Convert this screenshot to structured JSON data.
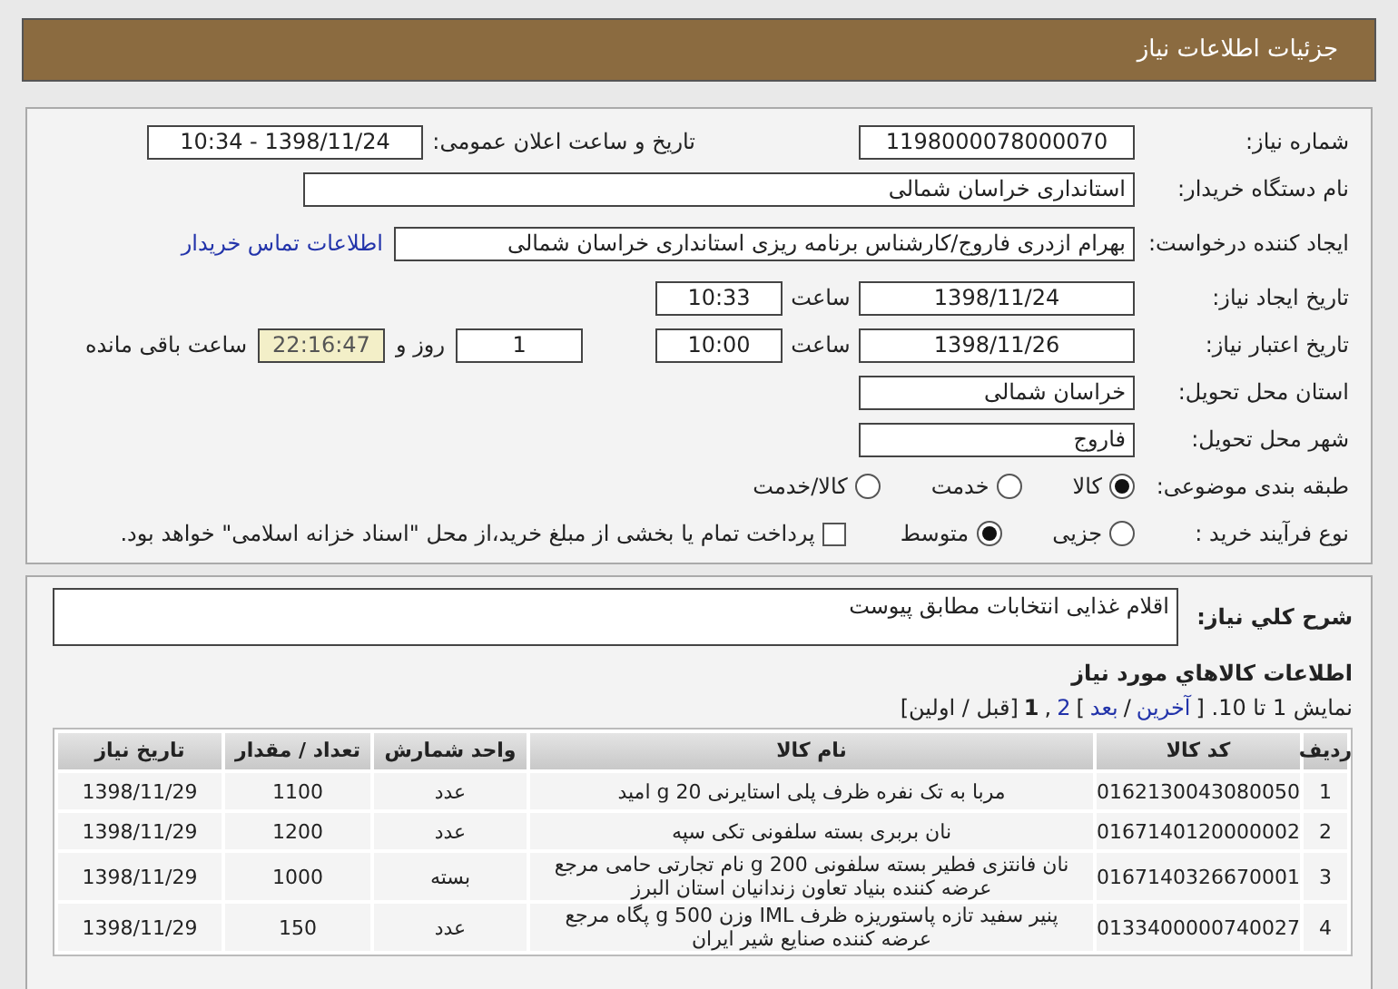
{
  "header": {
    "title": "جزئیات اطلاعات نیاز"
  },
  "details": {
    "need_number": {
      "label": "شماره نیاز:",
      "value": "1198000078000070"
    },
    "announce": {
      "label": "تاریخ و ساعت اعلان عمومی:",
      "value": "1398/11/24 - 10:34"
    },
    "buyer": {
      "label": "نام دستگاه خریدار:",
      "value": "استانداری خراسان شمالی"
    },
    "requester": {
      "label": "ایجاد کننده درخواست:",
      "value": "بهرام ازدری فاروج/کارشناس برنامه ریزی استانداری خراسان شمالی",
      "link": "اطلاعات تماس خریدار"
    },
    "created": {
      "label": "تاریخ ایجاد نیاز:",
      "date": "1398/11/24",
      "time_label": "ساعت",
      "time": "10:33"
    },
    "validity": {
      "label": "تاریخ اعتبار نیاز:",
      "date": "1398/11/26",
      "time_label": "ساعت",
      "time": "10:00",
      "days": "1",
      "days_label": "روز و",
      "remaining": "22:16:47",
      "remaining_label": "ساعت باقی مانده"
    },
    "province": {
      "label": "استان محل تحویل:",
      "value": "خراسان شمالی"
    },
    "city": {
      "label": "شهر محل تحویل:",
      "value": "فاروج"
    },
    "category": {
      "label": "طبقه بندی موضوعی:",
      "options": [
        {
          "label": "کالا",
          "selected": true
        },
        {
          "label": "خدمت",
          "selected": false
        },
        {
          "label": "کالا/خدمت",
          "selected": false
        }
      ]
    },
    "process": {
      "label": "نوع فرآیند خرید :",
      "options": [
        {
          "label": "جزیی",
          "selected": false
        },
        {
          "label": "متوسط",
          "selected": true
        }
      ],
      "payment": {
        "checked": false,
        "text": "پرداخت تمام یا بخشی از مبلغ خرید،از محل \"اسناد خزانه اسلامی\" خواهد بود."
      }
    }
  },
  "description": {
    "label": "شرح کلي نياز:",
    "value": "اقلام غذایی انتخابات مطابق پیوست"
  },
  "goods": {
    "title": "اطلاعات کالاهاي مورد نياز",
    "pagination": [
      {
        "kind": "text",
        "text": "نمایش 1 تا 10. ["
      },
      {
        "kind": "link",
        "text": "آخرین"
      },
      {
        "kind": "text",
        "text": "/"
      },
      {
        "kind": "link",
        "text": "بعد"
      },
      {
        "kind": "text",
        "text": "]"
      },
      {
        "kind": "link",
        "text": "2"
      },
      {
        "kind": "text",
        "text": ","
      },
      {
        "kind": "current",
        "text": "1"
      },
      {
        "kind": "text",
        "text": "[قبل / اولین]"
      }
    ],
    "columns": [
      "ردیف",
      "کد کالا",
      "نام کالا",
      "واحد شمارش",
      "تعداد / مقدار",
      "تاریخ نیاز"
    ],
    "rows": [
      [
        "1",
        "0162130043080050",
        "مربا به تک نفره ظرف پلی استایرنی 20 g امید",
        "عدد",
        "1100",
        "1398/11/29"
      ],
      [
        "2",
        "0167140120000002",
        "نان بربری بسته سلفونی تکی سپه",
        "عدد",
        "1200",
        "1398/11/29"
      ],
      [
        "3",
        "0167140326670001",
        "نان فانتزی فطیر بسته سلفونی 200 g نام تجارتی حامی مرجع عرضه کننده بنیاد تعاون زندانیان استان البرز",
        "بسته",
        "1000",
        "1398/11/29"
      ],
      [
        "4",
        "0133400000740027",
        "پنیر سفید تازه پاستوریزه ظرف IML وزن 500 g پگاه مرجع عرضه کننده صنایع شیر ایران",
        "عدد",
        "150",
        "1398/11/29"
      ]
    ]
  }
}
